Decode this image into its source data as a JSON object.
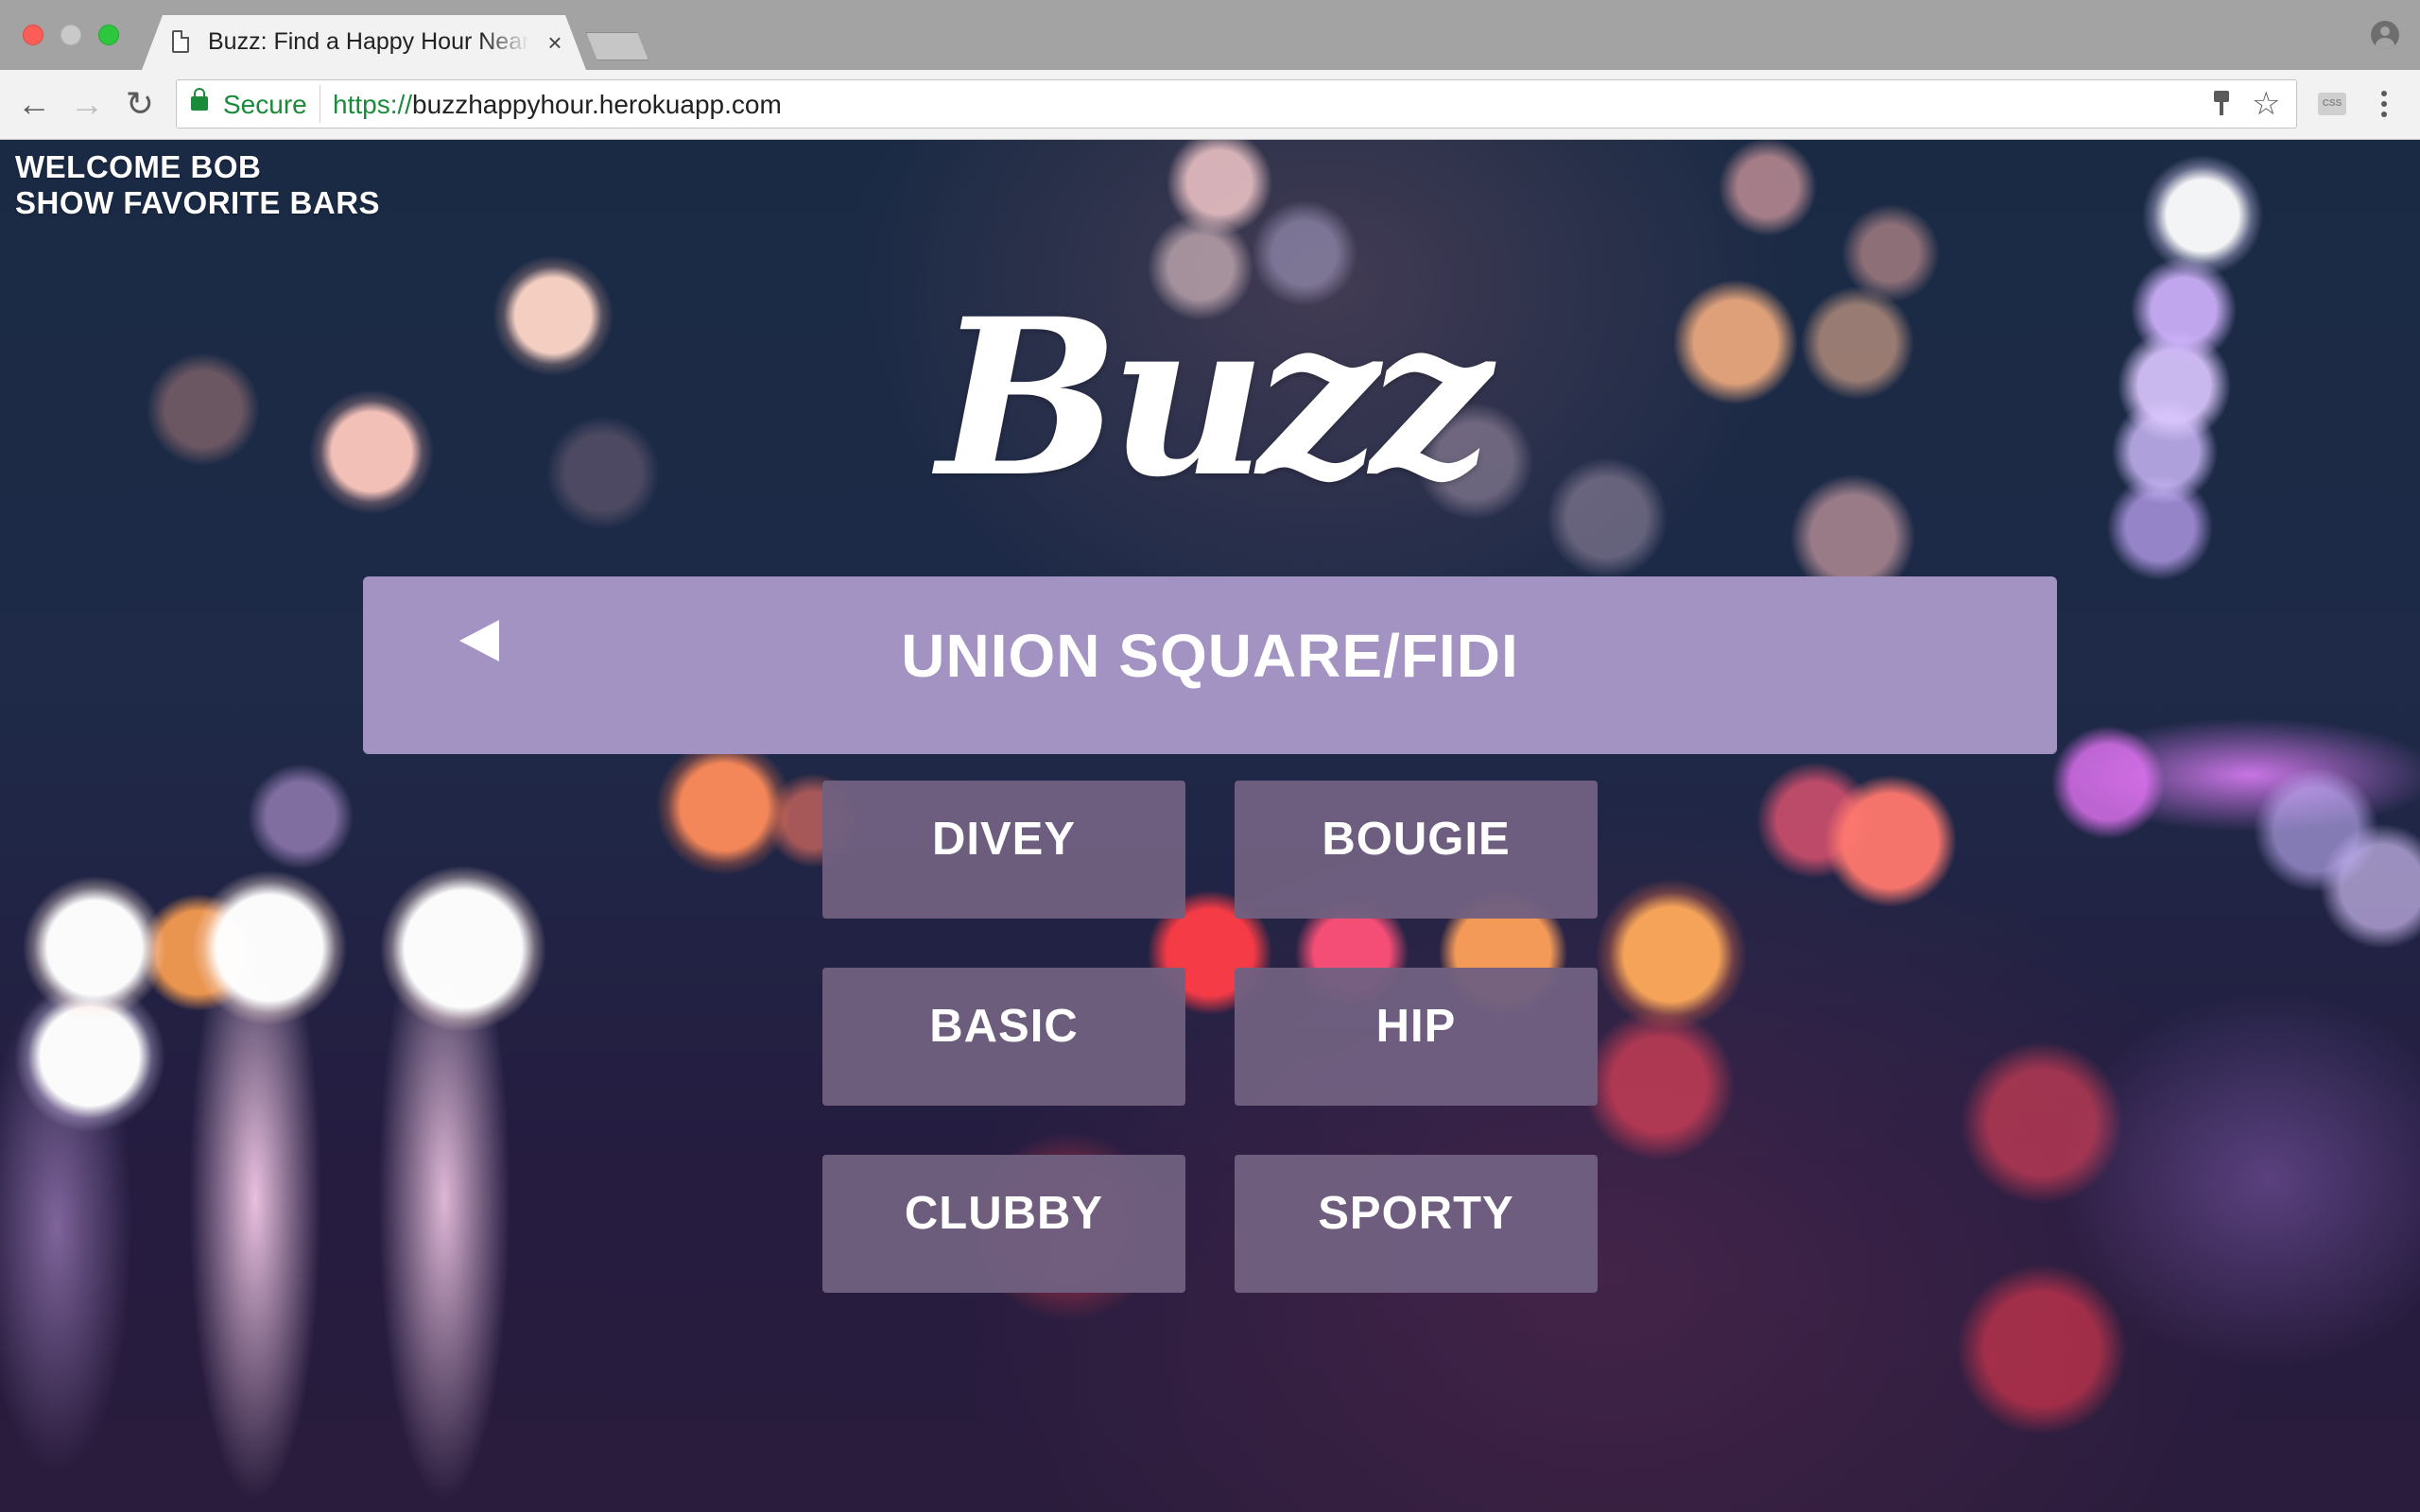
{
  "browser": {
    "tab_title": "Buzz: Find a Happy Hour Near You",
    "tab_close": "×",
    "security_label": "Secure",
    "url_scheme": "https://",
    "url_host": "buzzhappyhour.herokuapp.com",
    "nav": {
      "back": "←",
      "forward": "→",
      "reload": "↻"
    },
    "star": "☆",
    "ext_label": "CSS"
  },
  "page": {
    "welcome": "WELCOME BOB",
    "favorites_link": "SHOW FAVORITE BARS",
    "logo": "Buzz",
    "neighborhood": "UNION SQUARE/FIDI",
    "vibes": [
      "DIVEY",
      "BOUGIE",
      "BASIC",
      "HIP",
      "CLUBBY",
      "SPORTY"
    ]
  },
  "colors": {
    "neighborhood_bar": "#a393c2",
    "vibe_button": "#706080",
    "secure_green": "#1b8a3a"
  }
}
